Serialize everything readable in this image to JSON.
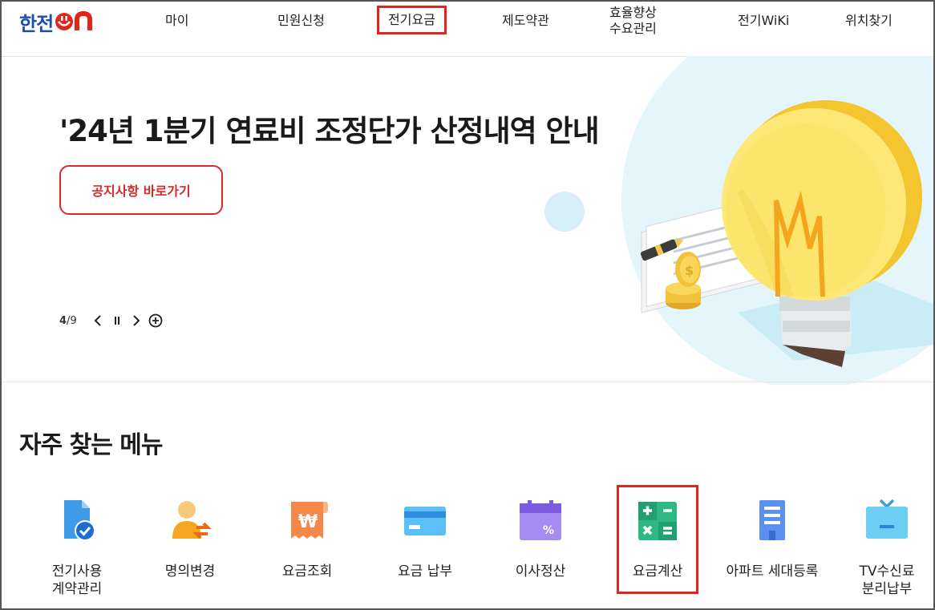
{
  "header": {
    "logo_text": "한전",
    "nav": [
      {
        "label": "마이"
      },
      {
        "label": "민원신청"
      },
      {
        "label": "전기요금",
        "active": true
      },
      {
        "label": "제도약관"
      },
      {
        "label": "효율향상\n수요관리"
      },
      {
        "label": "전기WiKi"
      },
      {
        "label": "위치찾기"
      }
    ]
  },
  "hero": {
    "title": "'24년 1분기 연료비 조정단가 산정내역 안내",
    "button_label": "공지사항 바로가기",
    "slide_current": "4",
    "slide_separator": "/",
    "slide_total": "9"
  },
  "quick_menu": {
    "title": "자주 찾는 메뉴",
    "items": [
      {
        "label": "전기사용\n계약관리",
        "icon": "contract-document-icon"
      },
      {
        "label": "명의변경",
        "icon": "person-change-icon"
      },
      {
        "label": "요금조회",
        "icon": "won-receipt-icon"
      },
      {
        "label": "요금 납부",
        "icon": "credit-card-icon"
      },
      {
        "label": "이사정산",
        "icon": "calendar-percent-icon"
      },
      {
        "label": "요금계산",
        "icon": "calculator-icon",
        "highlighted": true
      },
      {
        "label": "아파트 세대등록",
        "icon": "apartment-icon"
      },
      {
        "label": "TV수신료\n분리납부",
        "icon": "tv-icon"
      }
    ]
  },
  "colors": {
    "brand_blue": "#1d4fa8",
    "brand_red": "#e0251b",
    "highlight": "#e0251b"
  }
}
